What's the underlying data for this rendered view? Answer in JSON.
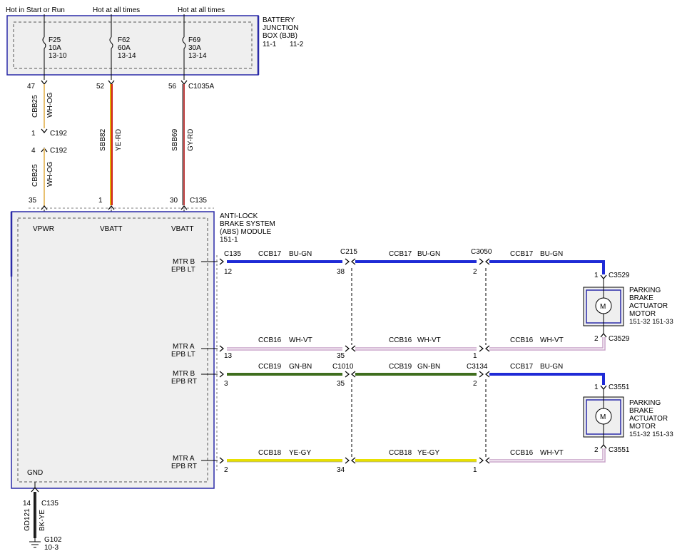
{
  "top_labels": {
    "f25": "Hot in Start or Run",
    "f62": "Hot at all times",
    "f69": "Hot at all times"
  },
  "bjb": {
    "line1": "BATTERY",
    "line2": "JUNCTION",
    "line3": "BOX (BJB)",
    "ref1": "11-1",
    "ref2": "11-2",
    "fuses": [
      {
        "name": "F25",
        "amps": "10A",
        "ref": "13-10"
      },
      {
        "name": "F62",
        "amps": "60A",
        "ref": "13-14"
      },
      {
        "name": "F69",
        "amps": "30A",
        "ref": "13-14"
      }
    ]
  },
  "feed_wires": {
    "cbb25_pin_top": "47",
    "cbb25_circuit": "CBB25",
    "cbb25_color": "WH-OG",
    "c192_pin1": "1",
    "c192_top": "C192",
    "c192_pin4": "4",
    "c192_bottom": "C192",
    "cbb25b_circuit": "CBB25",
    "cbb25b_color": "WH-OG",
    "cbb25b_pin": "35",
    "sbb82_pin_top": "52",
    "sbb82_circuit": "SBB82",
    "sbb82_color": "YE-RD",
    "sbb82_pin": "1",
    "sbb69_pin_top": "56",
    "c1035a": "C1035A",
    "sbb69_circuit": "SBB69",
    "sbb69_color": "GY-RD",
    "sbb69_pin": "30",
    "c135": "C135"
  },
  "abs": {
    "line1": "ANTI-LOCK",
    "line2": "BRAKE SYSTEM",
    "line3": "(ABS) MODULE",
    "ref": "151-1",
    "vpwr": "VPWR",
    "vbatt1": "VBATT",
    "vbatt2": "VBATT",
    "gnd": "GND",
    "outputs": [
      {
        "line1": "MTR B",
        "line2": "EPB LT"
      },
      {
        "line1": "MTR A",
        "line2": "EPB LT"
      },
      {
        "line1": "MTR B",
        "line2": "EPB RT"
      },
      {
        "line1": "MTR A",
        "line2": "EPB RT"
      }
    ]
  },
  "rows": [
    {
      "c135": "C135",
      "pin_abs": "12",
      "seg1_circuit": "CCB17",
      "seg1_color": "BU-GN",
      "conn1": "C215",
      "pin_c1": "38",
      "seg2_circuit": "CCB17",
      "seg2_color": "BU-GN",
      "conn2": "C3050",
      "pin_c2": "2",
      "seg3_circuit": "CCB17",
      "seg3_color": "BU-GN",
      "motor_pin": "1",
      "motor_conn": "C3529"
    },
    {
      "pin_abs": "13",
      "seg1_circuit": "CCB16",
      "seg1_color": "WH-VT",
      "pin_c1": "35",
      "seg2_circuit": "CCB16",
      "seg2_color": "WH-VT",
      "pin_c2": "1",
      "seg3_circuit": "CCB16",
      "seg3_color": "WH-VT",
      "motor_pin": "2",
      "motor_conn": "C3529"
    },
    {
      "pin_abs": "3",
      "seg1_circuit": "CCB19",
      "seg1_color": "GN-BN",
      "conn1": "C1010",
      "pin_c1": "35",
      "seg2_circuit": "CCB19",
      "seg2_color": "GN-BN",
      "conn2": "C3134",
      "pin_c2": "2",
      "seg3_circuit": "CCB17",
      "seg3_color": "BU-GN",
      "motor_pin": "1",
      "motor_conn": "C3551"
    },
    {
      "pin_abs": "2",
      "seg1_circuit": "CCB18",
      "seg1_color": "YE-GY",
      "pin_c1": "34",
      "seg2_circuit": "CCB18",
      "seg2_color": "YE-GY",
      "pin_c2": "1",
      "seg3_circuit": "CCB16",
      "seg3_color": "WH-VT",
      "motor_pin": "2",
      "motor_conn": "C3551"
    }
  ],
  "motors": [
    {
      "line1": "PARKING",
      "line2": "BRAKE",
      "line3": "ACTUATOR",
      "line4": "MOTOR",
      "ref": "151-32  151-33",
      "symbol": "M"
    },
    {
      "line1": "PARKING",
      "line2": "BRAKE",
      "line3": "ACTUATOR",
      "line4": "MOTOR",
      "ref": "151-32  151-33",
      "symbol": "M"
    }
  ],
  "ground": {
    "pin": "14",
    "conn": "C135",
    "circuit": "GD121",
    "color": "BK-YE",
    "point": "G102",
    "ref": "10-3"
  },
  "colors": {
    "BU-GN": "#1f2bd6",
    "WH-VT": "#c9a3c9",
    "GN-BN": "#3f6e1e",
    "YE-GY": "#e8e000",
    "YE-RD": "#d9b400",
    "GY-RD": "#b05050",
    "WH-OG": "#e8c070",
    "BK-YE": "#1a1a1a",
    "box_border": "#2a2aa8",
    "box_fill": "#efefef"
  }
}
